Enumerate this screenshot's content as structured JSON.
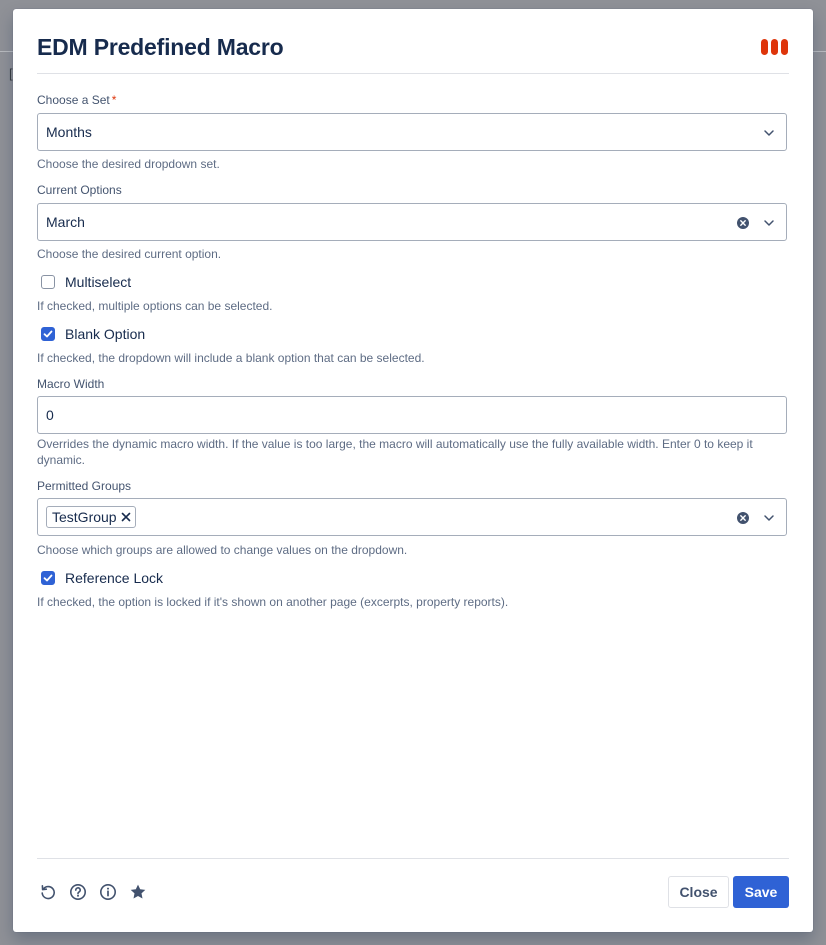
{
  "background": {
    "fragment": "["
  },
  "modal": {
    "title": "EDM Predefined Macro",
    "logo_icon": "three-red-bars-icon",
    "accent_color": "#de350b"
  },
  "fields": {
    "choose_set": {
      "label": "Choose a Set",
      "required_marker": "*",
      "value": "Months",
      "help": "Choose the desired dropdown set."
    },
    "current_options": {
      "label": "Current Options",
      "value": "March",
      "help": "Choose the desired current option."
    },
    "multiselect": {
      "label": "Multiselect",
      "checked": false,
      "help": "If checked, multiple options can be selected."
    },
    "blank_option": {
      "label": "Blank Option",
      "checked": true,
      "help": "If checked, the dropdown will include a blank option that can be selected."
    },
    "macro_width": {
      "label": "Macro Width",
      "value": "0",
      "help": "Overrides the dynamic macro width. If the value is too large, the macro will automatically use the fully available width. Enter 0 to keep it dynamic."
    },
    "permitted_groups": {
      "label": "Permitted Groups",
      "tags": [
        "TestGroup"
      ],
      "help": "Choose which groups are allowed to change values on the dropdown."
    },
    "reference_lock": {
      "label": "Reference Lock",
      "checked": true,
      "help": "If checked, the option is locked if it's shown on another page (excerpts, property reports)."
    }
  },
  "footer": {
    "icons": [
      "reset-icon",
      "help-icon",
      "info-icon",
      "star-icon"
    ],
    "close_label": "Close",
    "save_label": "Save",
    "primary_color": "#2f62d5"
  }
}
